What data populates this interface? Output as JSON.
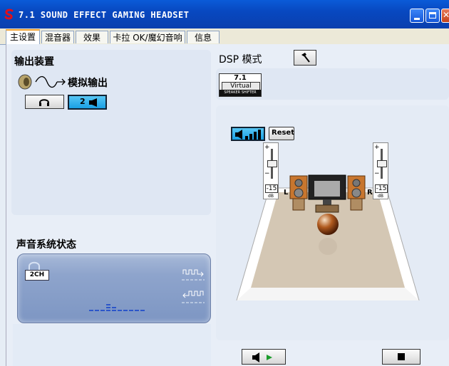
{
  "window": {
    "title": "7.1 SOUND EFFECT GAMING HEADSET",
    "icon": "app-logo-icon"
  },
  "tabs": [
    {
      "label": "主设置",
      "active": true
    },
    {
      "label": "混音器",
      "active": false
    },
    {
      "label": "效果",
      "active": false
    },
    {
      "label": "卡拉 OK/魔幻音响",
      "active": false
    },
    {
      "label": "信息",
      "active": false
    }
  ],
  "output": {
    "heading": "输出装置",
    "device_label": "模拟输出",
    "headphone_button_icon": "headphone-icon",
    "speaker_button_label": "2",
    "speaker_button_icon": "speaker-icon",
    "selected": "speaker"
  },
  "dsp": {
    "heading": "DSP 模式",
    "tool_icon": "hammer-icon",
    "badge_top": "7.1",
    "badge_mid": "Virtual",
    "badge_bottom": "SPEAKER SHIFTER"
  },
  "stage": {
    "reset_label": "Reset",
    "volume_icon": "volume-bars-icon",
    "left": {
      "plus": "+",
      "minus": "−",
      "value": "-15",
      "unit": "dB",
      "channel": "L"
    },
    "right": {
      "plus": "+",
      "minus": "−",
      "value": "-15",
      "unit": "dB",
      "channel": "R"
    }
  },
  "status": {
    "heading": "声音系统状态",
    "channel_badge": "2CH"
  },
  "transport": {
    "play_icon": "speaker-play-icon",
    "stop_icon": "stop-icon"
  },
  "colors": {
    "title_bar": "#0a4fc8",
    "accent_blue": "#1aa0e4",
    "panel": "#dfe7f3"
  }
}
